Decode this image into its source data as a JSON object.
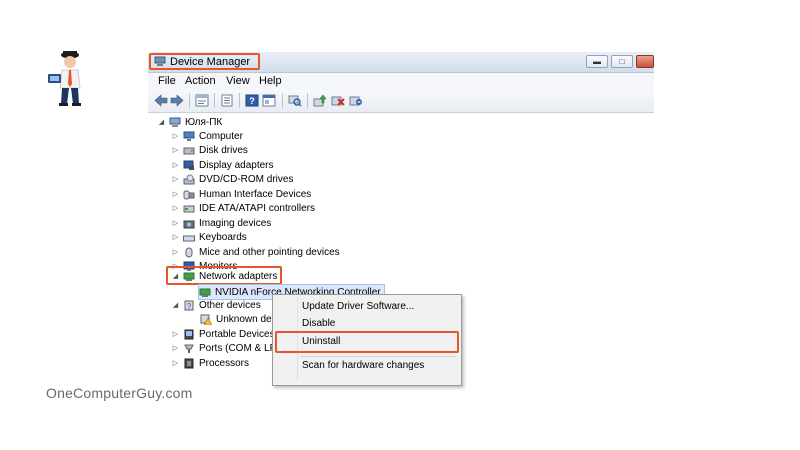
{
  "window": {
    "title": "Device Manager",
    "controls": [
      "minimize",
      "maximize",
      "close"
    ]
  },
  "menu": [
    "File",
    "Action",
    "View",
    "Help"
  ],
  "toolbar": [
    "back-icon",
    "forward-icon",
    "show-hide-tree-icon",
    "properties-icon",
    "help-icon",
    "properties-pane-icon",
    "scan-hardware-icon",
    "update-driver-icon",
    "disable-device-icon",
    "uninstall-device-icon"
  ],
  "tree": {
    "root": "Юля-ПК",
    "items": [
      {
        "label": "Computer",
        "icon": "computer-icon"
      },
      {
        "label": "Disk drives",
        "icon": "disk-drive-icon"
      },
      {
        "label": "Display adapters",
        "icon": "display-adapter-icon"
      },
      {
        "label": "DVD/CD-ROM drives",
        "icon": "dvd-drive-icon"
      },
      {
        "label": "Human Interface Devices",
        "icon": "hid-icon"
      },
      {
        "label": "IDE ATA/ATAPI controllers",
        "icon": "ide-controller-icon"
      },
      {
        "label": "Imaging devices",
        "icon": "imaging-icon"
      },
      {
        "label": "Keyboards",
        "icon": "keyboard-icon"
      },
      {
        "label": "Mice and other pointing devices",
        "icon": "mouse-icon"
      },
      {
        "label": "Monitors",
        "icon": "monitor-icon"
      },
      {
        "label": "Network adapters",
        "icon": "network-adapter-icon",
        "expanded": true
      },
      {
        "label": "NVIDIA nForce Networking Controller",
        "icon": "network-card-icon",
        "child": true,
        "selected": true
      },
      {
        "label": "Other devices",
        "icon": "other-devices-icon",
        "expanded": true
      },
      {
        "label": "Unknown device",
        "icon": "warning-device-icon",
        "child": true
      },
      {
        "label": "Portable Devices",
        "icon": "portable-device-icon"
      },
      {
        "label": "Ports (COM & LPT)",
        "icon": "port-icon"
      },
      {
        "label": "Processors",
        "icon": "processor-icon"
      }
    ]
  },
  "context_menu": {
    "items": [
      "Update Driver Software...",
      "Disable",
      "Uninstall",
      "Scan for hardware changes"
    ],
    "highlighted": "Uninstall"
  },
  "branding": {
    "site": "OneComputerGuy.com"
  },
  "colors": {
    "highlight_border": "#e8552b",
    "title_gradient_top": "#e9eff7",
    "selection": "#dbe8fb"
  }
}
